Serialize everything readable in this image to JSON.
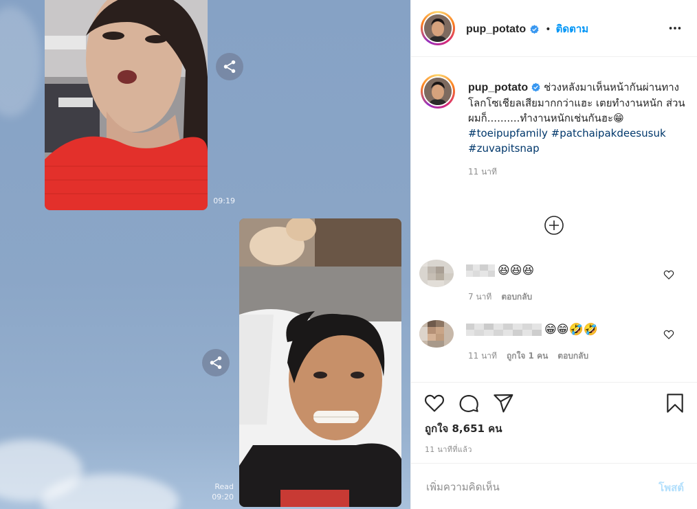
{
  "media": {
    "timestamp_1": "09:19",
    "read_label": "Read",
    "timestamp_2": "09:20"
  },
  "header": {
    "username": "pup_potato",
    "separator": "•",
    "follow_label": "ติดตาม"
  },
  "caption": {
    "username": "pup_potato",
    "text": "ช่วงหลังมาเห็นหน้ากันผ่านทางโลกโซเชียลเสียมากกว่าแฮะ เตยทำงานหนัก ส่วนผมก็..........ทำงานหนักเช่นกันฮะ😁",
    "hashtags": [
      "#toeipupfamily",
      "#patchaipakdeesusuk",
      "#zuvapitsnap"
    ],
    "time": "11 นาที"
  },
  "comments": [
    {
      "emojis": "😆😆😆",
      "time": "7 นาที",
      "likes": "",
      "reply_label": "ตอบกลับ"
    },
    {
      "emojis": "😁😁🤣🤣",
      "time": "11 นาที",
      "likes": "ถูกใจ 1 คน",
      "reply_label": "ตอบกลับ"
    }
  ],
  "actions": {
    "likes_text": "ถูกใจ 8,651 คน",
    "posted_time": "11 นาทีที่แล้ว"
  },
  "add_comment": {
    "placeholder": "เพิ่มความคิดเห็น",
    "post_label": "โพสต์"
  },
  "icons": [
    "share-icon",
    "verified-badge-icon",
    "more-options-icon",
    "load-more-comments-icon",
    "heart-icon",
    "comment-icon",
    "send-icon",
    "bookmark-icon"
  ],
  "colors": {
    "accent": "#0095f6",
    "hashtag": "#00376b",
    "muted": "#8e8e8e",
    "post_disabled": "#b2dffc",
    "chat_bg": "#8ba6c7"
  }
}
